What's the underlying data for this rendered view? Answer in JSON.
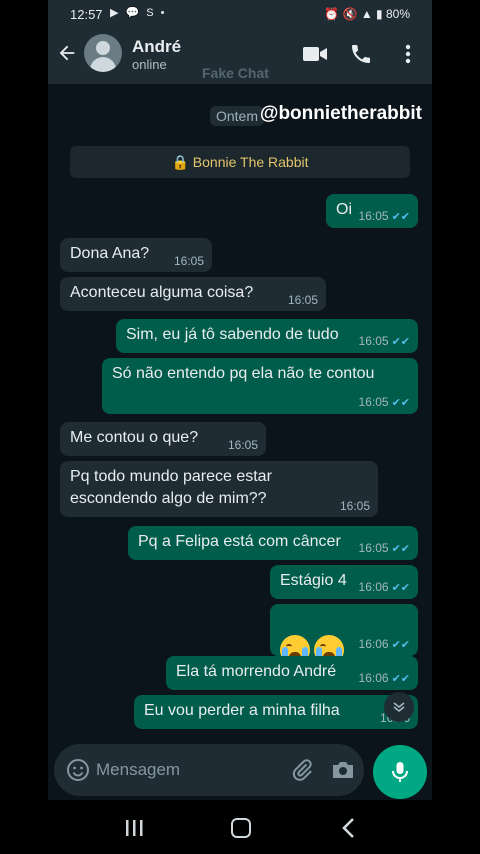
{
  "statusbar": {
    "time": "12:57",
    "left_icons": "▶ 💬 S •",
    "battery": "80%"
  },
  "header": {
    "contact_name": "André",
    "contact_status": "online",
    "watermark": "Fake Chat"
  },
  "overlay": {
    "date_chip": "Ontem",
    "handle": "@bonnietherabbit"
  },
  "system_banner": {
    "text": "Bonnie The Rabbit",
    "icon": "lock-icon"
  },
  "messages": [
    {
      "direction": "out",
      "text": "Oi",
      "time": "16:05"
    },
    {
      "direction": "in",
      "text": "Dona Ana?",
      "time": "16:05"
    },
    {
      "direction": "in",
      "text": "Aconteceu alguma coisa?",
      "time": "16:05"
    },
    {
      "direction": "out",
      "text": "Sim, eu já tô sabendo de tudo",
      "time": "16:05"
    },
    {
      "direction": "out",
      "text": "Só não entendo pq ela não te contou",
      "time": "16:05"
    },
    {
      "direction": "in",
      "text": "Me contou o que?",
      "time": "16:05"
    },
    {
      "direction": "in",
      "text": "Pq todo mundo parece estar\nescondendo algo de mim??",
      "time": "16:05"
    },
    {
      "direction": "out",
      "text": "Pq a Felipa está com câncer",
      "time": "16:05"
    },
    {
      "direction": "out",
      "text": "Estágio 4",
      "time": "16:06"
    },
    {
      "direction": "out",
      "text": "",
      "emoji": "loudly-crying-face x2",
      "time": "16:06"
    },
    {
      "direction": "out",
      "text": "Ela tá morrendo André",
      "time": "16:06"
    },
    {
      "direction": "out",
      "text": "Eu vou perder a minha filha",
      "time": "16:06"
    }
  ],
  "composer": {
    "placeholder": "Mensagem"
  },
  "colors": {
    "header_bg": "#1f2c34",
    "chat_bg": "#0b141a",
    "incoming_bubble": "#1f2c34",
    "outgoing_bubble": "#005c4b",
    "accent": "#00a884",
    "read_tick": "#53bdeb"
  }
}
